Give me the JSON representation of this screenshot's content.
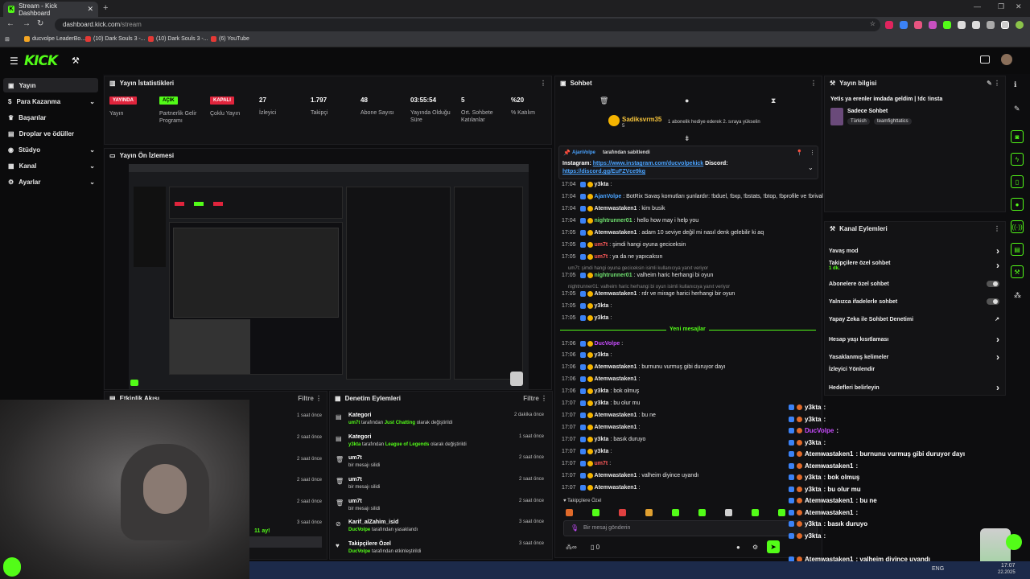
{
  "browser": {
    "tab_title": "Stream - Kick Dashboard",
    "tab_favicon": "K",
    "url": "dashboard.kick.com/stream",
    "url_host": "dashboard.kick.com",
    "url_path": "/stream",
    "bookmarks": [
      "ducvolpe LeaderBo...",
      "(10) Dark Souls 3 -...",
      "(10) Dark Souls 3 -...",
      "(6) YouTube"
    ]
  },
  "app": {
    "logo": "KICK",
    "brand_color": "#53fc18"
  },
  "sidebar": {
    "items": [
      {
        "label": "Yayın",
        "icon": "broadcast-icon"
      },
      {
        "label": "Para Kazanma",
        "icon": "dollar-icon"
      },
      {
        "label": "Başarılar",
        "icon": "trophy-icon"
      },
      {
        "label": "Droplar ve ödüller",
        "icon": "gift-icon"
      },
      {
        "label": "Stüdyo",
        "icon": "studio-icon"
      },
      {
        "label": "Kanal",
        "icon": "channel-icon"
      },
      {
        "label": "Ayarlar",
        "icon": "gear-icon"
      }
    ]
  },
  "stats": {
    "title": "Yayın İstatistikleri",
    "items": [
      {
        "value": "YAYINDA",
        "label": "Yayın",
        "kind": "badge-red"
      },
      {
        "value": "AÇIK",
        "label": "Partnerlik Gelir Programı",
        "kind": "badge-green"
      },
      {
        "value": "KAPALI",
        "label": "Çoklu Yayın",
        "kind": "badge-red"
      },
      {
        "value": "27",
        "label": "İzleyici"
      },
      {
        "value": "1.797",
        "label": "Takipçi"
      },
      {
        "value": "48",
        "label": "Abone Sayısı"
      },
      {
        "value": "03:55:54",
        "label": "Yayında Olduğu Süre"
      },
      {
        "value": "5",
        "label": "Ort. Sohbete Katılanlar"
      },
      {
        "value": "%20",
        "label": "% Katılım"
      }
    ]
  },
  "preview": {
    "title": "Yayın Ön İzlemesi"
  },
  "chat": {
    "title": "Sohbet",
    "gift_user": "Sadiksvrm35",
    "gift_level": "5",
    "gift_text": "1 abonelik hediye ederek 2. sıraya yükselin",
    "pinned_by": "AjanVolpe",
    "pinned_suffix": "tarafından sabitlendi",
    "pinned_msg_prefix": "Instagram:",
    "pinned_link1": "https://www.instagram.com/ducvolpekick",
    "pinned_msg_mid": "Discord:",
    "pinned_link2": "https://discord.gg/EuFZVce9kg",
    "lines": [
      {
        "t": "17:04",
        "u": "y3kta",
        "c": "#e8e8e8",
        "m": ":"
      },
      {
        "t": "17:04",
        "u": "AjanVolpe",
        "c": "#4aa3ff",
        "m": ": BotRix Savaş komutları şunlardır: !bduel, !bxp, !bstats, !btop, !bprofile ve !brival"
      },
      {
        "t": "17:04",
        "u": "Atemwastaken1",
        "c": "#e8e8e8",
        "m": ": kim busik"
      },
      {
        "t": "17:04",
        "u": "nightrunner01",
        "c": "#6fe06f",
        "m": ": hello how may i help you"
      },
      {
        "t": "17:05",
        "u": "Atemwastaken1",
        "c": "#e8e8e8",
        "m": ": adam 10 seviye değil mi nasıl denk gelebilir ki aq"
      },
      {
        "t": "17:05",
        "u": "um7t",
        "c": "#ff5a5a",
        "m": ": şimdi hangi oyuna geciceksin"
      },
      {
        "t": "17:05",
        "u": "um7t",
        "c": "#ff5a5a",
        "m": ": ya da ne yapıcaksın"
      }
    ],
    "reply1": "um7t: şimdi hangi oyuna geciceksin isimli kullanıcıya yanıt veriyor",
    "lines2": [
      {
        "t": "17:05",
        "u": "nightrunner01",
        "c": "#6fe06f",
        "m": ": valheim haric herhangi bi oyun"
      }
    ],
    "reply2": "nightrunner01: valheim haric herhangi bi oyun isimli kullanıcıya yanıt veriyor",
    "lines3": [
      {
        "t": "17:05",
        "u": "Atemwastaken1",
        "c": "#e8e8e8",
        "m": ": rdr ve mirage harici herhangi bir oyun"
      },
      {
        "t": "17:05",
        "u": "y3kta",
        "c": "#e8e8e8",
        "m": ":"
      },
      {
        "t": "17:05",
        "u": "y3kta",
        "c": "#e8e8e8",
        "m": ":"
      }
    ],
    "new_messages": "Yeni mesajlar",
    "lines4": [
      {
        "t": "17:06",
        "u": "DucVolpe",
        "c": "#c94cff",
        "m": ":"
      },
      {
        "t": "17:06",
        "u": "y3kta",
        "c": "#e8e8e8",
        "m": ":"
      },
      {
        "t": "17:06",
        "u": "Atemwastaken1",
        "c": "#e8e8e8",
        "m": ": burnunu vurmuş gibi duruyor dayı"
      },
      {
        "t": "17:06",
        "u": "Atemwastaken1",
        "c": "#e8e8e8",
        "m": ":"
      },
      {
        "t": "17:06",
        "u": "y3kta",
        "c": "#e8e8e8",
        "m": ": bok olmuş"
      },
      {
        "t": "17:07",
        "u": "y3kta",
        "c": "#e8e8e8",
        "m": ": bu olur mu"
      },
      {
        "t": "17:07",
        "u": "Atemwastaken1",
        "c": "#e8e8e8",
        "m": ": bu ne"
      },
      {
        "t": "17:07",
        "u": "Atemwastaken1",
        "c": "#e8e8e8",
        "m": ":"
      },
      {
        "t": "17:07",
        "u": "y3kta",
        "c": "#e8e8e8",
        "m": ": basık duruyo"
      },
      {
        "t": "17:07",
        "u": "y3kta",
        "c": "#e8e8e8",
        "m": ":"
      },
      {
        "t": "17:07",
        "u": "um7t",
        "c": "#ff5a5a",
        "m": ":"
      },
      {
        "t": "17:07",
        "u": "Atemwastaken1",
        "c": "#e8e8e8",
        "m": ": valheim diyince uyandı"
      },
      {
        "t": "17:07",
        "u": "Atemwastaken1",
        "c": "#e8e8e8",
        "m": ":"
      }
    ],
    "followers_only": "Takipçilere Özel",
    "input_placeholder": "Bir mesaj gönderin",
    "footer_count": "0"
  },
  "stream_info": {
    "title": "Yayın bilgisi",
    "stream_title": "Yetis ya erenler imdada geldim | !dc !insta",
    "category": "Sadece Sohbet",
    "tags": [
      "Türkish",
      "teamfighttatics"
    ]
  },
  "channel_actions": {
    "title": "Kanal Eylemleri",
    "items": [
      {
        "label": "Yavaş mod",
        "right": "chevron"
      },
      {
        "label": "Takipçilere özel sohbet",
        "sub": "1 dk.",
        "right": "chevron"
      },
      {
        "label": "Abonelere özel sohbet",
        "right": "toggle"
      },
      {
        "label": "Yalnızca ifadelerle sohbet",
        "right": "toggle"
      },
      {
        "label": "Yapay Zeka ile Sohbet Denetimi",
        "right": "external"
      },
      {
        "label": "Hesap yaşı kısıtlaması",
        "right": "chevron"
      },
      {
        "label": "Yasaklanmış kelimeler",
        "right": "chevron"
      },
      {
        "label": "İzleyici Yönlendir",
        "right": ""
      },
      {
        "label": "Hedefleri belirleyin",
        "right": "chevron"
      }
    ]
  },
  "events": {
    "title": "Etkinlik Akışı",
    "filter": "Filtre",
    "times": [
      "1 saat önce",
      "2 saat önce",
      "2 saat önce",
      "2 saat önce",
      "2 saat önce",
      "3 saat önce"
    ],
    "snippet": "11 ay!"
  },
  "mod": {
    "title": "Denetim Eylemleri",
    "filter": "Filtre",
    "items": [
      {
        "icon": "category-icon",
        "title": "Kategori",
        "u": "um7t",
        "mid": " tarafından ",
        "v": "Just Chatting",
        "end": " olarak değiştirildi",
        "time": "2 dakika önce"
      },
      {
        "icon": "category-icon",
        "title": "Kategori",
        "u": "y3kta",
        "mid": " tarafından ",
        "v": "League of Legends",
        "end": "  olarak değiştirildi",
        "time": "1 saat önce"
      },
      {
        "icon": "trash-icon",
        "title": "um7t",
        "u": "",
        "mid": "bir mesajı silidi",
        "v": "",
        "end": "",
        "time": "2 saat önce"
      },
      {
        "icon": "trash-icon",
        "title": "um7t",
        "u": "",
        "mid": "bir mesajı silidi",
        "v": "",
        "end": "",
        "time": "2 saat önce"
      },
      {
        "icon": "trash-icon",
        "title": "um7t",
        "u": "",
        "mid": "bir mesajı silidi",
        "v": "",
        "end": "",
        "time": "2 saat önce"
      },
      {
        "icon": "ban-icon",
        "title": "Karif_alZahim_isid",
        "u": "DucVolpe",
        "mid": " tarafından yasaklandı",
        "v": "",
        "end": "",
        "time": "3 saat önce"
      },
      {
        "icon": "heart-icon",
        "title": "Takipçilere Özel",
        "u": "DucVolpe",
        "mid": " tarafından etkinleştirildi",
        "v": "",
        "end": "",
        "time": "3 saat önce"
      }
    ]
  },
  "overlay_chat": [
    {
      "u": "y3kta",
      "m": ":"
    },
    {
      "u": "y3kta",
      "m": ":"
    },
    {
      "u": "DucVolpe",
      "m": ":"
    },
    {
      "u": "y3kta",
      "m": ":"
    },
    {
      "u": "Atemwastaken1",
      "m": ": burnunu vurmuş gibi duruyor dayı"
    },
    {
      "u": "Atemwastaken1",
      "m": ":"
    },
    {
      "u": "y3kta",
      "m": ": bok olmuş"
    },
    {
      "u": "y3kta",
      "m": ": bu olur mu"
    },
    {
      "u": "Atemwastaken1",
      "m": ": bu ne"
    },
    {
      "u": "Atemwastaken1",
      "m": ":"
    },
    {
      "u": "y3kta",
      "m": ": basık duruyo"
    },
    {
      "u": "y3kta",
      "m": ":"
    },
    {
      "u": "",
      "m": ""
    },
    {
      "u": "Atemwastaken1",
      "m": ": valheim diyince uyandı"
    },
    {
      "u": "Atemwastaken1",
      "m": ":"
    }
  ],
  "taskbar": {
    "lang": "ENG",
    "time": "17:07",
    "date": "22.2025"
  }
}
